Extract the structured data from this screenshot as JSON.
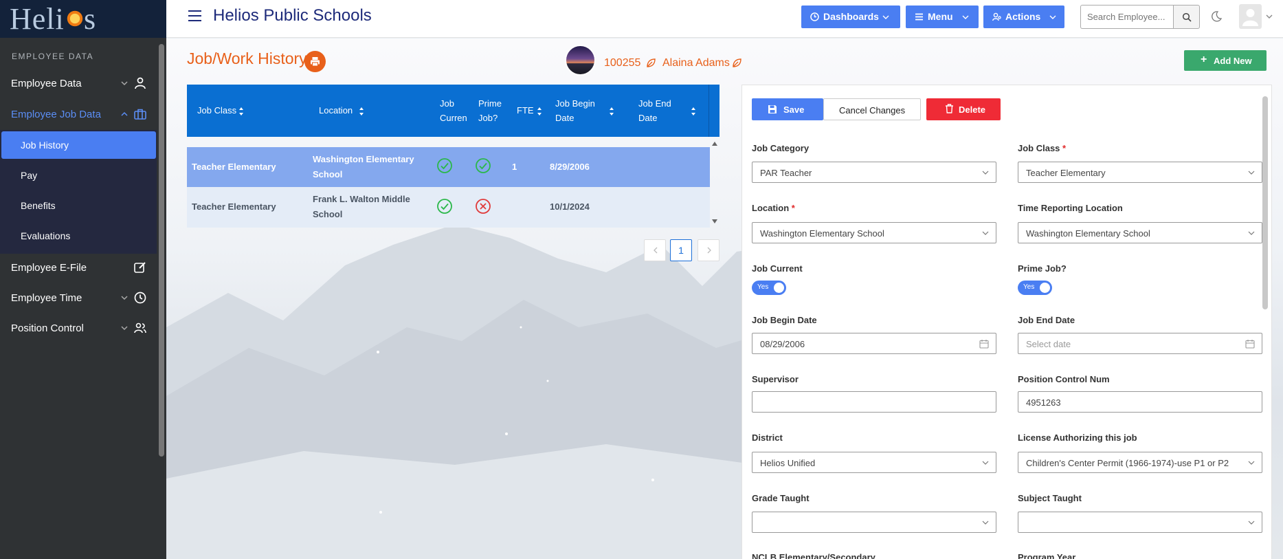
{
  "brand": {
    "logo_left": "Heli",
    "logo_right": "s"
  },
  "sidebar": {
    "section_title": "EMPLOYEE DATA",
    "items": [
      {
        "label": "Employee Data",
        "icon": "user-icon"
      },
      {
        "label": "Employee Job Data",
        "icon": "briefcase-icon"
      },
      {
        "label": "Employee E-File",
        "icon": "edit-icon"
      },
      {
        "label": "Employee Time",
        "icon": "clock-icon"
      },
      {
        "label": "Position Control",
        "icon": "users-icon"
      }
    ],
    "subitems": [
      {
        "label": "Job History",
        "active": true
      },
      {
        "label": "Pay"
      },
      {
        "label": "Benefits"
      },
      {
        "label": "Evaluations"
      }
    ]
  },
  "header": {
    "school_name": "Helios Public Schools",
    "buttons": [
      {
        "label": "Dashboards",
        "icon": "dashboard-icon"
      },
      {
        "label": "Menu",
        "icon": "list-icon"
      },
      {
        "label": "Actions",
        "icon": "user-cog-icon"
      }
    ],
    "search_placeholder": "Search Employee..."
  },
  "page": {
    "title": "Job/Work History",
    "employee_id": "100255",
    "employee_name": "Alaina Adams",
    "add_new_label": "Add New"
  },
  "table": {
    "columns": [
      "Job Class",
      "Location",
      "Job Curren",
      "Prime Job?",
      "FTE",
      "Job Begin Date",
      "Job End Date"
    ],
    "rows": [
      {
        "job_class": "Teacher Elementary",
        "location": "Washington Elementary School",
        "job_current": true,
        "prime_job": true,
        "fte": "1",
        "begin": "8/29/2006",
        "end": ""
      },
      {
        "job_class": "Teacher Elementary",
        "location": "Frank L. Walton Middle School",
        "job_current": true,
        "prime_job": false,
        "fte": "",
        "begin": "10/1/2024",
        "end": ""
      }
    ],
    "pagination": {
      "current_page": "1"
    }
  },
  "form": {
    "save_label": "Save",
    "cancel_label": "Cancel Changes",
    "delete_label": "Delete",
    "job_category": {
      "label": "Job Category",
      "value": "PAR Teacher"
    },
    "job_class": {
      "label": "Job Class",
      "value": "Teacher Elementary"
    },
    "location": {
      "label": "Location",
      "value": "Washington Elementary School"
    },
    "time_reporting_location": {
      "label": "Time Reporting Location",
      "value": "Washington Elementary School"
    },
    "job_current": {
      "label": "Job Current",
      "value": "Yes"
    },
    "prime_job": {
      "label": "Prime Job?",
      "value": "Yes"
    },
    "job_begin_date": {
      "label": "Job Begin Date",
      "value": "08/29/2006"
    },
    "job_end_date": {
      "label": "Job End Date",
      "placeholder": "Select date"
    },
    "supervisor": {
      "label": "Supervisor",
      "value": ""
    },
    "position_control_num": {
      "label": "Position Control Num",
      "value": "4951263"
    },
    "district": {
      "label": "District",
      "value": "Helios Unified"
    },
    "license": {
      "label": "License Authorizing this job",
      "value": "Children's Center Permit (1966-1974)-use P1 or P2"
    },
    "grade_taught": {
      "label": "Grade Taught",
      "value": ""
    },
    "subject_taught": {
      "label": "Subject Taught",
      "value": ""
    },
    "nclb": {
      "label": "NCLB Elementary/Secondary"
    },
    "program_year": {
      "label": "Program Year"
    }
  },
  "colors": {
    "accent": "#4a7ef2",
    "header_blue": "#0a6fd2",
    "title_orange": "#e8601a",
    "delete_red": "#ef2b36",
    "add_green": "#3aa86d"
  }
}
